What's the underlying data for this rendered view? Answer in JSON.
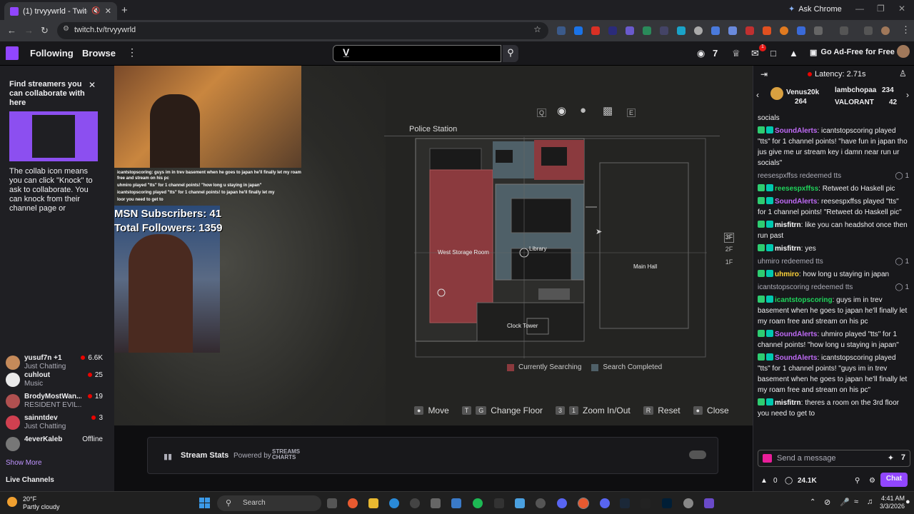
{
  "browser": {
    "tab_title": "(1) trvyywrld - Twitch",
    "url": "twitch.tv/trvyywrld",
    "ask_chrome": "Ask Chrome",
    "new_tab": "+"
  },
  "topnav": {
    "following": "Following",
    "browse": "Browse",
    "notif_count": "1",
    "ad_free": "Go Ad-Free for Free",
    "search_logo": "V̲"
  },
  "sidebar": {
    "collab_title": "Find streamers you can collaborate with here",
    "collab_text": "The collab icon means you can click \"Knock\" to ask to collaborate. You can knock from their channel page or",
    "channels": [
      {
        "name": "yusuf7n +1",
        "game": "Just Chatting",
        "viewers": "6.6K",
        "color": "#c58a5a",
        "live": true
      },
      {
        "name": "cuhlout",
        "game": "Music",
        "viewers": "25",
        "color": "#eaeaea",
        "live": true
      },
      {
        "name": "BrodyMostWan...",
        "game": "RESIDENT EVIL...",
        "viewers": "19",
        "color": "#b05050",
        "live": true
      },
      {
        "name": "sainntdev",
        "game": "Just Chatting",
        "viewers": "3",
        "color": "#d04050",
        "live": true
      },
      {
        "name": "4everKaleb",
        "game": "",
        "viewers": "Offline",
        "color": "#777",
        "live": false
      }
    ],
    "show_more": "Show More",
    "live_channels": "Live Channels"
  },
  "video": {
    "overlay_chat": [
      "icantstopscoring: guys im in trev basement when he goes to japan he'll finally let my roam free and stream on his pc",
      "uhmiro played \"tts\" for 1 channel points! \"how long u staying in japan\"",
      "icantstopscoring played \"tts\" for 1 channel points! to japan he'll finally let my",
      "loor you need to get to"
    ],
    "msn_subs": "MSN Subscribers: 41",
    "total_followers": "Total Followers: 1359",
    "map": {
      "tabs": [
        "Q",
        "E"
      ],
      "area": "Police Station",
      "rooms": [
        "West Storage Room",
        "Library",
        "Main Hall",
        "Clock Tower"
      ],
      "floors": [
        "3F",
        "2F",
        "1F"
      ],
      "legend": [
        {
          "label": "Currently Searching",
          "color": "#8b3a3e"
        },
        {
          "label": "Search Completed",
          "color": "#4f6068"
        }
      ],
      "controls": [
        {
          "keys": [
            "●"
          ],
          "label": "Move"
        },
        {
          "keys": [
            "T",
            "G"
          ],
          "label": "Change Floor"
        },
        {
          "keys": [
            "3",
            "1"
          ],
          "label": "Zoom In/Out"
        },
        {
          "keys": [
            "R"
          ],
          "label": "Reset"
        },
        {
          "keys": [
            "●"
          ],
          "label": "Close"
        }
      ]
    }
  },
  "stream_stats": {
    "title": "Stream Stats",
    "powered": "Powered by",
    "brand": "STREAMS CHARTS"
  },
  "chat": {
    "latency": "Latency: 2.71s",
    "hype": [
      {
        "name": "Venus20k",
        "count": "264"
      },
      {
        "name": "lambchopaa",
        "count": "234"
      },
      {
        "name": "VALORANT",
        "count": "42"
      }
    ],
    "messages": [
      {
        "type": "text",
        "text": "socials"
      },
      {
        "type": "msg",
        "user": "SoundAlerts",
        "color": "#c06bf7",
        "text": ": icantstopscoring played \"tts\" for 1 channel points! \"have fun in japan tho jus give me ur stream key i damn near run ur socials\""
      },
      {
        "type": "redeem",
        "text": "reesespxffss redeemed tts",
        "pts": "1"
      },
      {
        "type": "msg",
        "user": "reesespxffss",
        "color": "#1fd45b",
        "text": ": Retweet do Haskell pic"
      },
      {
        "type": "msg",
        "user": "SoundAlerts",
        "color": "#c06bf7",
        "text": ": reesespxffss played \"tts\" for 1 channel points! \"Retweet do Haskell pic\""
      },
      {
        "type": "msg",
        "user": "misfitrn",
        "color": "#ffffff",
        "text": ": like you can headshot once then run past"
      },
      {
        "type": "msg",
        "user": "misfitrn",
        "color": "#ffffff",
        "text": ": yes"
      },
      {
        "type": "redeem",
        "text": "uhmiro redeemed tts",
        "pts": "1"
      },
      {
        "type": "msg",
        "user": "uhmiro",
        "color": "#ffd43b",
        "text": ": how long u staying in japan"
      },
      {
        "type": "redeem",
        "text": "icantstopscoring redeemed tts",
        "pts": "1"
      },
      {
        "type": "msg",
        "user": "icantstopscoring",
        "color": "#1fd45b",
        "text": ": guys im in trev basement when he goes to japan he'll finally let my roam free and stream on his pc"
      },
      {
        "type": "msg",
        "user": "SoundAlerts",
        "color": "#c06bf7",
        "text": ": uhmiro played \"tts\" for 1 channel points! \"how long u staying in japan\""
      },
      {
        "type": "msg",
        "user": "SoundAlerts",
        "color": "#c06bf7",
        "text": ": icantstopscoring played \"tts\" for 1 channel points! \"guys im in trev basement when he goes to japan he'll finally let my roam free and stream on his pc\""
      },
      {
        "type": "msg",
        "user": "misfitrn",
        "color": "#ffffff",
        "text": ": theres a room on the 3rd floor you need to get to"
      }
    ],
    "input_placeholder": "Send a message",
    "bits": "0",
    "points": "24.1K",
    "chat_button": "Chat"
  },
  "taskbar": {
    "temp": "20°F",
    "weather": "Partly cloudy",
    "search": "Search",
    "time": "4:41 AM",
    "date": "3/3/2026"
  },
  "colors": {
    "accent": "#9146ff",
    "live": "#eb0400",
    "searching": "#8b3a3e",
    "completed": "#4f6068"
  }
}
